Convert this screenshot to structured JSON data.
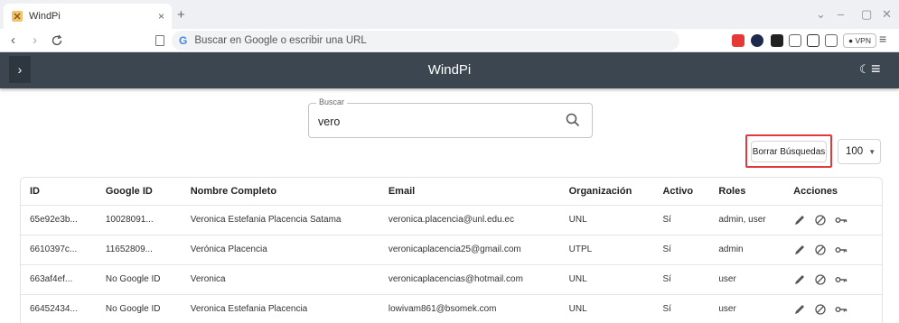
{
  "browser": {
    "tab_title": "WindPi",
    "tab_close": "×",
    "new_tab": "+",
    "address_placeholder": "Buscar en Google o escribir una URL",
    "google_glyph": "G",
    "vpn_label": "VPN",
    "extensions": [
      "mail-icon",
      "copyright-icon",
      "grid-icon",
      "puzzle-icon",
      "sidebar-icon",
      "window-icon"
    ]
  },
  "app": {
    "title": "WindPi",
    "drawer_toggle": "›",
    "theme_icon": "moon-icon",
    "menu_icon": "≡"
  },
  "search": {
    "legend": "Buscar",
    "value": "vero"
  },
  "controls": {
    "clear_label": "Borrar Búsquedas",
    "page_size": "100"
  },
  "table": {
    "columns": [
      "ID",
      "Google ID",
      "Nombre Completo",
      "Email",
      "Organización",
      "Activo",
      "Roles",
      "Acciones"
    ],
    "rows": [
      [
        "65e92e3b...",
        "10028091...",
        "Veronica Estefania Placencia Satama",
        "veronica.placencia@unl.edu.ec",
        "UNL",
        "Sí",
        "admin, user"
      ],
      [
        "6610397c...",
        "11652809...",
        "Verónica Placencia",
        "veronicaplacencia25@gmail.com",
        "UTPL",
        "Sí",
        "admin"
      ],
      [
        "663af4ef...",
        "No Google ID",
        "Veronica",
        "veronicaplacencias@hotmail.com",
        "UNL",
        "Sí",
        "user"
      ],
      [
        "66452434...",
        "No Google ID",
        "Veronica Estefania Placencia",
        "lowivam861@bsomek.com",
        "UNL",
        "Sí",
        "user"
      ]
    ]
  },
  "colors": {
    "appbar": "#3b4650",
    "highlight": "#e0393e"
  }
}
